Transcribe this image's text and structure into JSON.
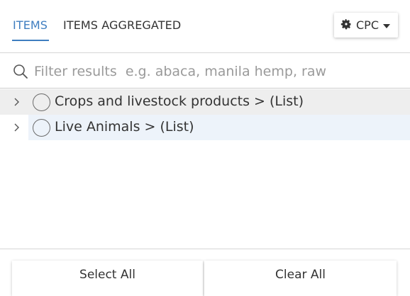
{
  "tabs": [
    {
      "label": "ITEMS",
      "active": true
    },
    {
      "label": "ITEMS AGGREGATED",
      "active": false
    }
  ],
  "classification": {
    "label": "CPC",
    "icon": "gear-icon"
  },
  "filter": {
    "placeholder": "Filter results  e.g. abaca, manila hemp, raw",
    "value": ""
  },
  "tree": {
    "items": [
      {
        "label": "Crops and livestock products > (List)"
      },
      {
        "label": "Live Animals > (List)"
      }
    ]
  },
  "footer": {
    "select_all_label": "Select All",
    "clear_all_label": "Clear All"
  },
  "colors": {
    "accent": "#3f7ec0",
    "row_hover": "#eeeeee",
    "row_highlight": "#edf3fa"
  }
}
